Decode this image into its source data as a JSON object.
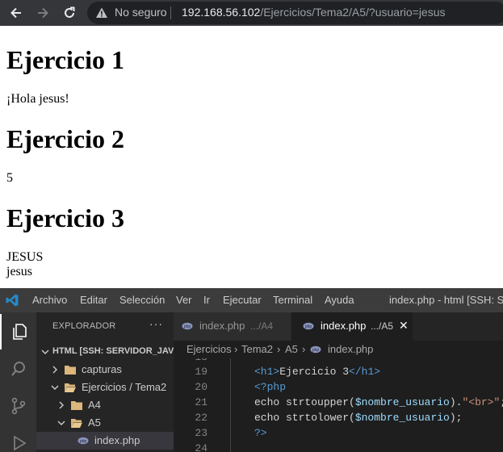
{
  "browser": {
    "security_label": "No seguro",
    "url_host": "192.168.56.102",
    "url_path": "/Ejercicios/Tema2/A5/?usuario=jesus"
  },
  "page": {
    "heading1": "Ejercicio 1",
    "text1": "¡Hola jesus!",
    "heading2": "Ejercicio 2",
    "text2": "5",
    "heading3": "Ejercicio 3",
    "text3a": "JESUS",
    "text3b": "jesus"
  },
  "vscode": {
    "menu": [
      "Archivo",
      "Editar",
      "Selección",
      "Ver",
      "Ir",
      "Ejecutar",
      "Terminal",
      "Ayuda"
    ],
    "window_title": "index.php - html [SSH: Serv",
    "sidebar": {
      "header": "EXPLORADOR",
      "more": "···",
      "section": "HTML [SSH: SERVIDOR_JAVI]",
      "tree": [
        "capturas",
        "Ejercicios / Tema2",
        "A4",
        "A5",
        "index.php"
      ]
    },
    "tabs": [
      {
        "name": "index.php",
        "path": ".../A4"
      },
      {
        "name": "index.php",
        "path": ".../A5",
        "close": "✕"
      }
    ],
    "breadcrumb": [
      "Ejercicios",
      "Tema2",
      "A5",
      "index.php"
    ],
    "code": {
      "line_numbers": [
        "18",
        "19",
        "20",
        "21",
        "22",
        "23",
        "24"
      ],
      "line19_open": "<h1>",
      "line19_text": "Ejercicio 3",
      "line19_close": "</h1>",
      "line20": "<?php",
      "line21_fn": "echo strtoupper(",
      "line21_var": "$nombre_usuario",
      "line21_mid": ").",
      "line21_str": "\"<br>\"",
      "line21_end": ";",
      "line22_fn": "echo strtolower(",
      "line22_var": "$nombre_usuario",
      "line22_end": ");",
      "line23": "?>"
    },
    "colors": {
      "tag": "#569cd6",
      "php_tag": "#569cd6",
      "variable": "#9cdcfe",
      "string": "#ce9178",
      "text": "#d4d4d4"
    }
  }
}
